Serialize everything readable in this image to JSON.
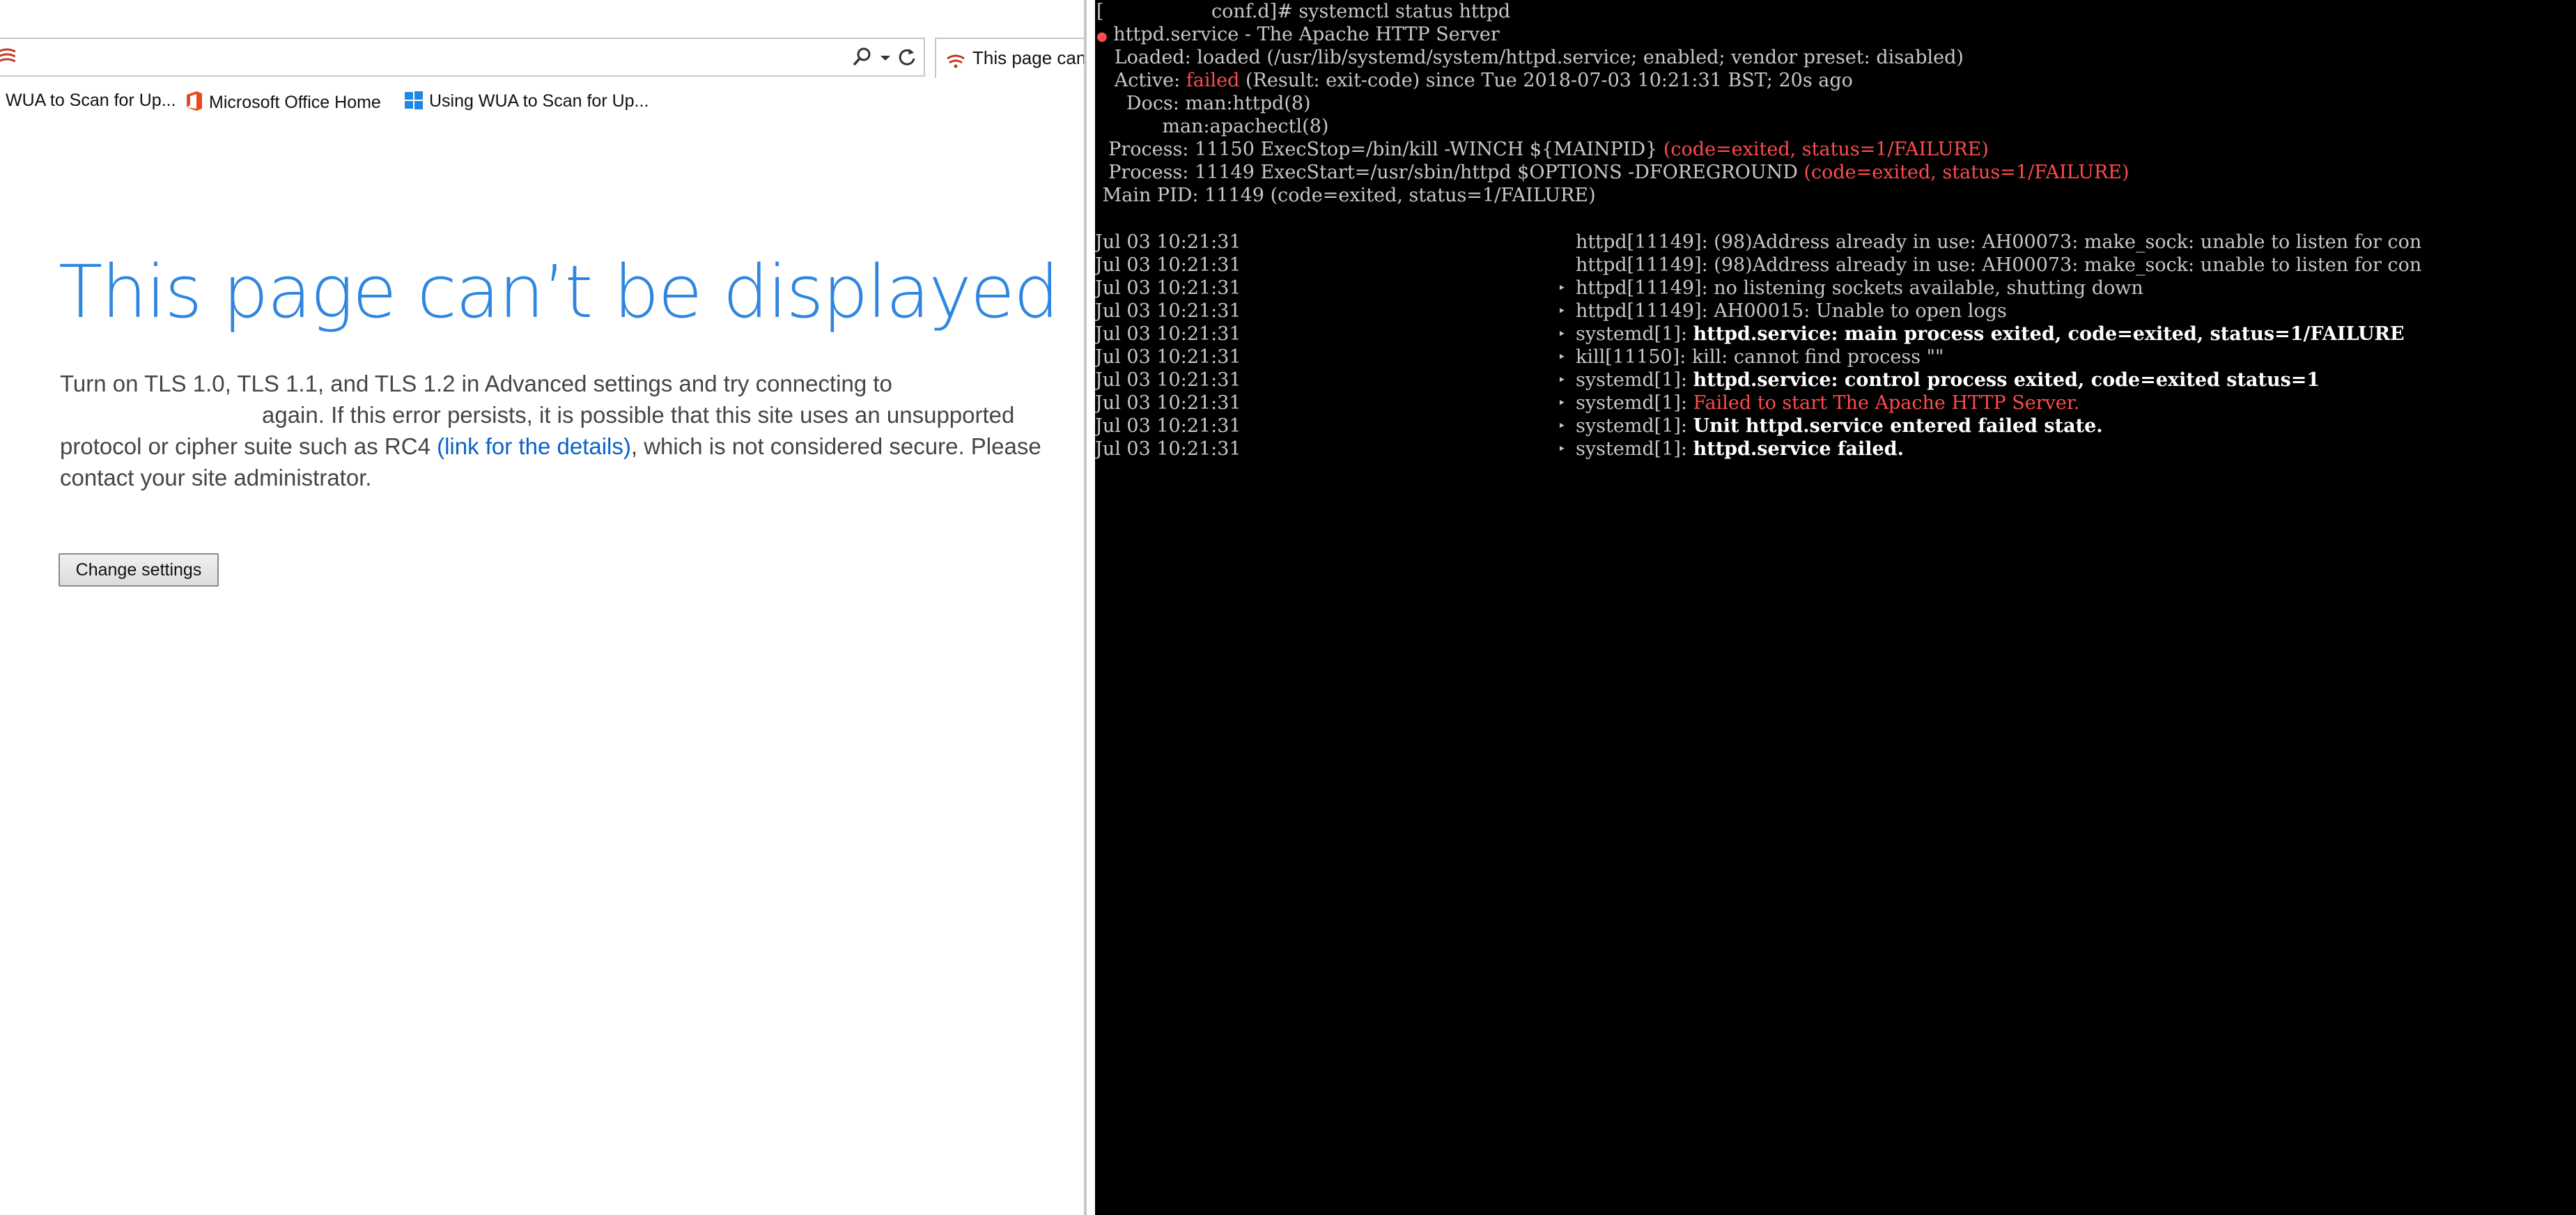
{
  "browser": {
    "tab_title": "This page can't",
    "favorites": [
      "WUA to Scan for Up...",
      "Microsoft Office Home",
      "Using WUA to Scan for Up..."
    ],
    "error_title": "This page can’t be displayed",
    "body_line1": "Turn on TLS 1.0, TLS 1.1, and TLS 1.2 in Advanced settings and try connecting to",
    "body_line2": "again. If this error persists, it is possible that this site uses an unsupported",
    "body_line3_pre": "protocol or cipher suite such as RC4 ",
    "link_text": "(link for the details)",
    "body_line3_post": ", which is not considered secure. Please",
    "body_line4": "contact your site administrator.",
    "change_settings_label": "Change settings",
    "colors": {
      "title": "#2f86e0",
      "link": "#0a62c7"
    }
  },
  "terminal": {
    "prompt": "[                  conf.d]# systemctl status httpd",
    "service_bullet": "●",
    "service_line": " httpd.service - The Apache HTTP Server",
    "loaded": "   Loaded: loaded (/usr/lib/systemd/system/httpd.service; enabled; vendor preset: disabled)",
    "active_prefix": "   Active: ",
    "active_state": "failed",
    "active_rest": " (Result: exit-code) since Tue 2018-07-03 10:21:31 BST; 20s ago",
    "docs1": "     Docs: man:httpd(8)",
    "docs2": "           man:apachectl(8)",
    "process1": "  Process: 11150 ExecStop=/bin/kill -WINCH ${MAINPID} ",
    "process1_status": "(code=exited, status=1/FAILURE)",
    "process2": "  Process: 11149 ExecStart=/usr/sbin/httpd $OPTIONS -DFOREGROUND ",
    "process2_status": "(code=exited, status=1/FAILURE)",
    "mainpid": " Main PID: 11149 (code=exited, status=1/FAILURE)",
    "log_time": "Jul 03 10:21:31",
    "log": [
      {
        "marker": "",
        "src": "httpd[11149]: ",
        "msg": "(98)Address already in use: AH00073: make_sock: unable to listen for con",
        "style": "normal"
      },
      {
        "marker": "",
        "src": "httpd[11149]: ",
        "msg": "(98)Address already in use: AH00073: make_sock: unable to listen for con",
        "style": "normal"
      },
      {
        "marker": "‣",
        "src": "httpd[11149]: ",
        "msg": "no listening sockets available, shutting down",
        "style": "normal"
      },
      {
        "marker": "‣",
        "src": "httpd[11149]: ",
        "msg": "AH00015: Unable to open logs",
        "style": "normal"
      },
      {
        "marker": "‣",
        "src": "systemd[1]: ",
        "msg": "httpd.service: main process exited, code=exited, status=1/FAILURE",
        "style": "bright"
      },
      {
        "marker": "‣",
        "src": "kill[11150]: ",
        "msg": "kill: cannot find process \"\"",
        "style": "normal"
      },
      {
        "marker": "‣",
        "src": "systemd[1]: ",
        "msg": "httpd.service: control process exited, code=exited status=1",
        "style": "bright"
      },
      {
        "marker": "‣",
        "src": "systemd[1]: ",
        "msg": "Failed to start The Apache HTTP Server.",
        "style": "red"
      },
      {
        "marker": "‣",
        "src": "systemd[1]: ",
        "msg": "Unit httpd.service entered failed state.",
        "style": "bright"
      },
      {
        "marker": "‣",
        "src": "systemd[1]: ",
        "msg": "httpd.service failed.",
        "style": "bright"
      }
    ],
    "colors": {
      "background": "#000000",
      "text": "#c8c8c8",
      "error": "#ff4c4c"
    }
  }
}
